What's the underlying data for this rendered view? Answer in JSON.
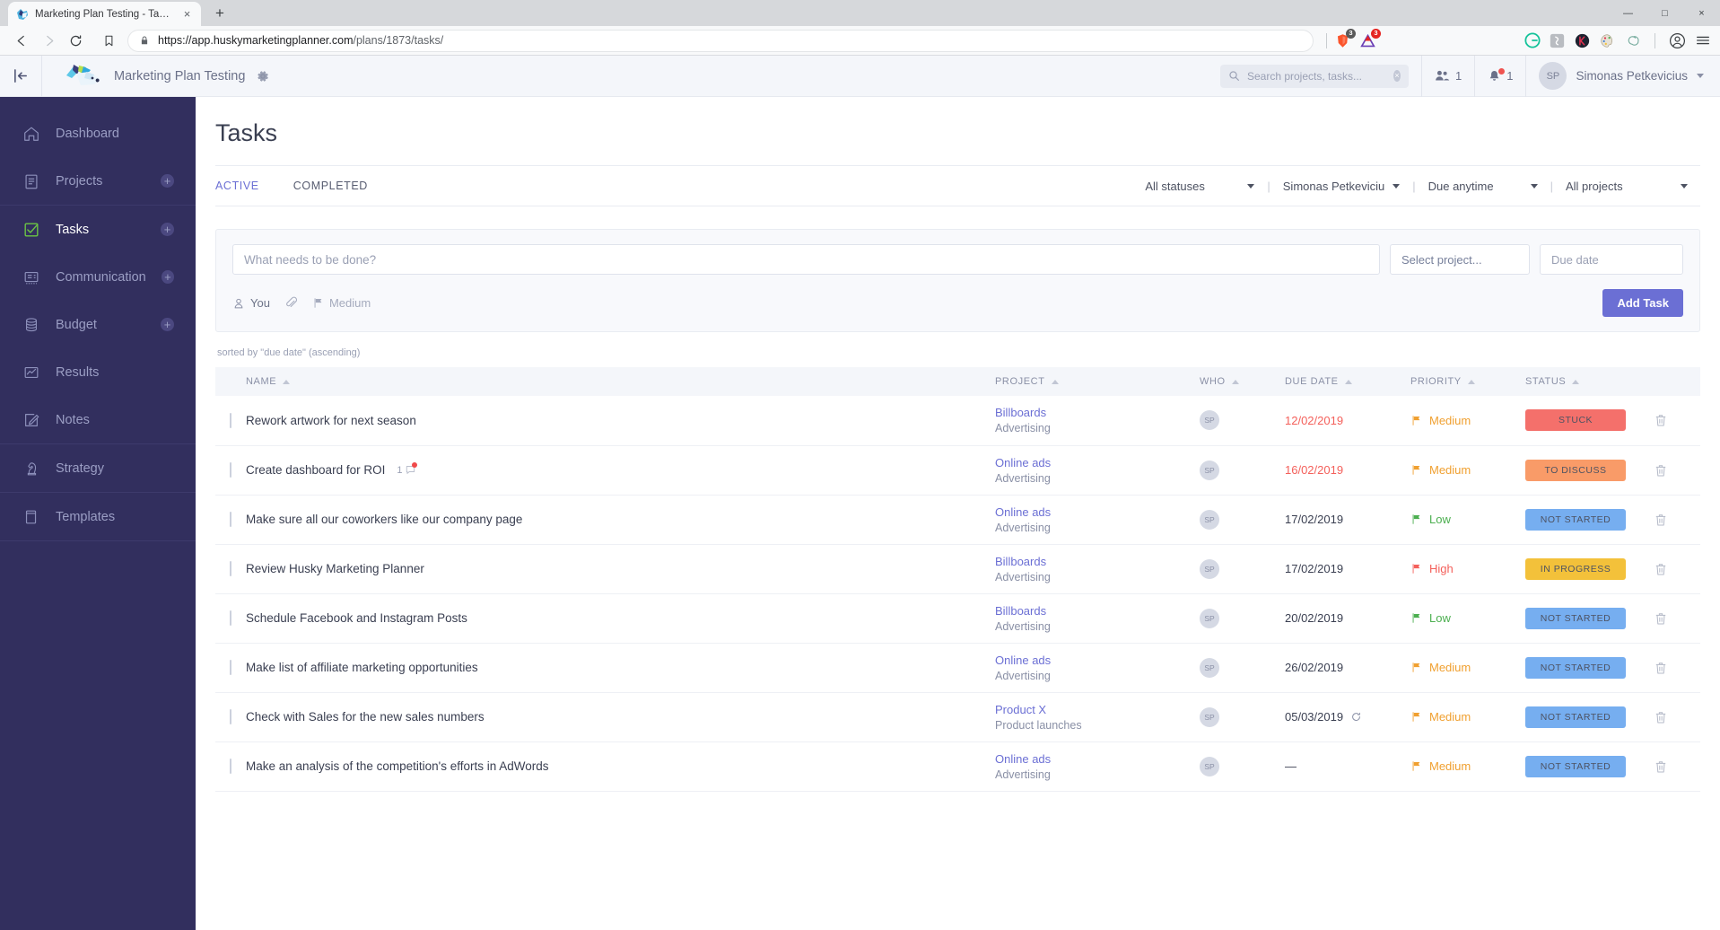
{
  "browser": {
    "tab": {
      "title": "Marketing Plan Testing - Tasks",
      "favicon": "husky-favicon",
      "close": "×"
    },
    "new_tab_label": "+",
    "nav": {
      "back": "back-arrow",
      "forward": "forward-arrow",
      "reload": "reload-icon"
    },
    "url": {
      "scheme_host": "https://app.huskymarketingplanner.com",
      "path": "/plans/1873/tasks/"
    },
    "extensions": [
      {
        "name": "brave-shield-icon",
        "badge": "3",
        "badge_color": "#5a5a5a"
      },
      {
        "name": "adobe-triangle-icon",
        "badge": "3",
        "badge_color": "#e52421"
      },
      {
        "name": "grammarly-icon",
        "badge": ""
      },
      {
        "name": "extension-gray-icon",
        "badge": ""
      },
      {
        "name": "k-extension-icon",
        "badge": ""
      },
      {
        "name": "palette-icon",
        "badge": ""
      },
      {
        "name": "openai-spiral-icon",
        "badge": ""
      }
    ],
    "profile_icon": "profile-icon",
    "menu_icon": "hamburger-menu-icon",
    "window": {
      "minimize": "—",
      "maximize": "□",
      "close": "×"
    }
  },
  "app_header": {
    "collapse_icon": "collapse-sidebar-icon",
    "logo": "husky-logo",
    "plan_name": "Marketing Plan Testing",
    "settings_icon": "gear-icon",
    "search": {
      "placeholder": "Search projects, tasks...",
      "value": "",
      "icon": "search-icon",
      "clear": "×"
    },
    "team_count": "1",
    "notifications_count": "1",
    "user": {
      "initials": "SP",
      "name": "Simonas Petkevicius"
    }
  },
  "sidebar": {
    "items": [
      {
        "label": "Dashboard",
        "icon": "home-icon",
        "active": false,
        "plus": false
      },
      {
        "label": "Projects",
        "icon": "document-list-icon",
        "active": false,
        "plus": true
      },
      {
        "label": "Tasks",
        "icon": "check-square-icon",
        "active": true,
        "plus": true
      },
      {
        "label": "Communication",
        "icon": "message-board-icon",
        "active": false,
        "plus": true
      },
      {
        "label": "Budget",
        "icon": "coins-icon",
        "active": false,
        "plus": true
      },
      {
        "label": "Results",
        "icon": "chart-icon",
        "active": false,
        "plus": false
      },
      {
        "label": "Notes",
        "icon": "pencil-note-icon",
        "active": false,
        "plus": false
      },
      {
        "label": "Strategy",
        "icon": "chess-knight-icon",
        "active": false,
        "plus": false
      },
      {
        "label": "Templates",
        "icon": "templates-icon",
        "active": false,
        "plus": false
      }
    ]
  },
  "main": {
    "title": "Tasks",
    "view_tabs": [
      {
        "label": "Active",
        "active": true
      },
      {
        "label": "Completed",
        "active": false
      }
    ],
    "filters": [
      {
        "label": "All statuses",
        "name": "status-filter"
      },
      {
        "label": "Simonas Petkeviciu",
        "name": "assignee-filter"
      },
      {
        "label": "Due anytime",
        "name": "due-filter"
      },
      {
        "label": "All projects",
        "name": "project-filter"
      }
    ],
    "filter_divider": "|",
    "add_task": {
      "input_placeholder": "What needs to be done?",
      "input_value": "",
      "project_select": "Select project...",
      "due_placeholder": "Due date",
      "due_value": "",
      "assignee": "You",
      "attach_icon": "paperclip-icon",
      "priority": "Medium",
      "button": "Add Task"
    },
    "sorted_note": "sorted by \"due date\" (ascending)",
    "columns": [
      {
        "label": "Name",
        "name": "col-name"
      },
      {
        "label": "Project",
        "name": "col-project"
      },
      {
        "label": "Who",
        "name": "col-who"
      },
      {
        "label": "Due Date",
        "name": "col-due-date"
      },
      {
        "label": "Priority",
        "name": "col-priority"
      },
      {
        "label": "Status",
        "name": "col-status"
      }
    ],
    "tasks": [
      {
        "name": "Rework artwork for next season",
        "comments": "",
        "project": "Billboards",
        "group": "Advertising",
        "who": "SP",
        "due": "12/02/2019",
        "overdue": true,
        "recurring": false,
        "priority": "Medium",
        "priority_color": "#f0a030",
        "status": "Stuck",
        "status_bg": "#f4706b",
        "status_color": "#4d5262"
      },
      {
        "name": "Create dashboard for ROI",
        "comments": "1",
        "project": "Online ads",
        "group": "Advertising",
        "who": "SP",
        "due": "16/02/2019",
        "overdue": true,
        "recurring": false,
        "priority": "Medium",
        "priority_color": "#f0a030",
        "status": "To discuss",
        "status_bg": "#f99b68",
        "status_color": "#4d5262"
      },
      {
        "name": "Make sure all our coworkers like our company page",
        "comments": "",
        "project": "Online ads",
        "group": "Advertising",
        "who": "SP",
        "due": "17/02/2019",
        "overdue": false,
        "recurring": false,
        "priority": "Low",
        "priority_color": "#4caf50",
        "status": "Not started",
        "status_bg": "#76aef0",
        "status_color": "#4d5262"
      },
      {
        "name": "Review Husky Marketing Planner",
        "comments": "",
        "project": "Billboards",
        "group": "Advertising",
        "who": "SP",
        "due": "17/02/2019",
        "overdue": false,
        "recurring": false,
        "priority": "High",
        "priority_color": "#f4605b",
        "status": "In progress",
        "status_bg": "#f3c13a",
        "status_color": "#4d5262"
      },
      {
        "name": "Schedule Facebook and Instagram Posts",
        "comments": "",
        "project": "Billboards",
        "group": "Advertising",
        "who": "SP",
        "due": "20/02/2019",
        "overdue": false,
        "recurring": false,
        "priority": "Low",
        "priority_color": "#4caf50",
        "status": "Not started",
        "status_bg": "#76aef0",
        "status_color": "#4d5262"
      },
      {
        "name": "Make list of affiliate marketing opportunities",
        "comments": "",
        "project": "Online ads",
        "group": "Advertising",
        "who": "SP",
        "due": "26/02/2019",
        "overdue": false,
        "recurring": false,
        "priority": "Medium",
        "priority_color": "#f0a030",
        "status": "Not started",
        "status_bg": "#76aef0",
        "status_color": "#4d5262"
      },
      {
        "name": "Check with Sales for the new sales numbers",
        "comments": "",
        "project": "Product X",
        "group": "Product launches",
        "who": "SP",
        "due": "05/03/2019",
        "overdue": false,
        "recurring": true,
        "priority": "Medium",
        "priority_color": "#f0a030",
        "status": "Not started",
        "status_bg": "#76aef0",
        "status_color": "#4d5262"
      },
      {
        "name": "Make an analysis of the competition's efforts in AdWords",
        "comments": "",
        "project": "Online ads",
        "group": "Advertising",
        "who": "SP",
        "due": "—",
        "overdue": false,
        "recurring": false,
        "priority": "Medium",
        "priority_color": "#f0a030",
        "status": "Not started",
        "status_bg": "#76aef0",
        "status_color": "#4d5262"
      }
    ]
  },
  "colors": {
    "accent": "#6b6fd4",
    "sidebar_bg": "#322f5e",
    "overdue": "#f4605b",
    "active_nav": "#6cc644"
  }
}
